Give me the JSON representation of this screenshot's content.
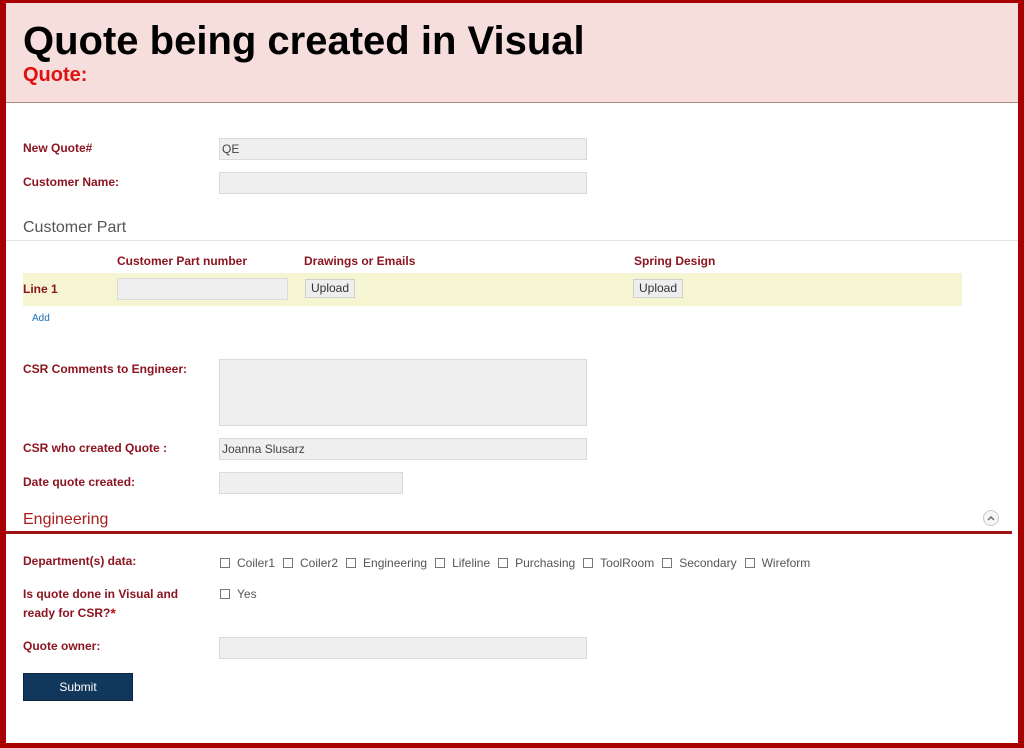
{
  "header": {
    "title": "Quote being created in Visual",
    "subtitle": "Quote:"
  },
  "fields": {
    "new_quote_label": "New Quote#",
    "new_quote_value": "QE",
    "customer_name_label": "Customer Name:",
    "customer_name_value": "",
    "csr_comments_label": "CSR Comments to Engineer:",
    "csr_comments_value": "",
    "csr_created_label": "CSR who created Quote :",
    "csr_created_value": "Joanna Slusarz",
    "date_created_label": "Date quote created:",
    "date_created_value": ""
  },
  "customer_part": {
    "section_title": "Customer Part",
    "columns": [
      "Customer Part number",
      "Drawings or Emails",
      "Spring Design"
    ],
    "line_label": "Line 1",
    "part_number_value": "",
    "upload_label": "Upload",
    "add_label": "Add"
  },
  "engineering": {
    "section_title": "Engineering",
    "departments_label": "Department(s) data:",
    "departments": [
      {
        "label": "Coiler1",
        "checked": false
      },
      {
        "label": "Coiler2",
        "checked": false
      },
      {
        "label": "Engineering",
        "checked": false
      },
      {
        "label": "Lifeline",
        "checked": false
      },
      {
        "label": "Purchasing",
        "checked": false
      },
      {
        "label": "ToolRoom",
        "checked": false
      },
      {
        "label": "Secondary",
        "checked": false
      },
      {
        "label": "Wireform",
        "checked": false
      }
    ],
    "quote_done_label_line1": "Is quote done in Visual and",
    "quote_done_label_line2": "ready for CSR?",
    "required_mark": "*",
    "yes_label": "Yes",
    "quote_owner_label": "Quote owner:",
    "quote_owner_value": ""
  },
  "submit_label": "Submit",
  "colors": {
    "frame": "#a80000",
    "header_bg": "#f5dedb",
    "label": "#8b1520",
    "line_row_bg": "#f6f5d1",
    "submit_bg": "#12375c"
  }
}
